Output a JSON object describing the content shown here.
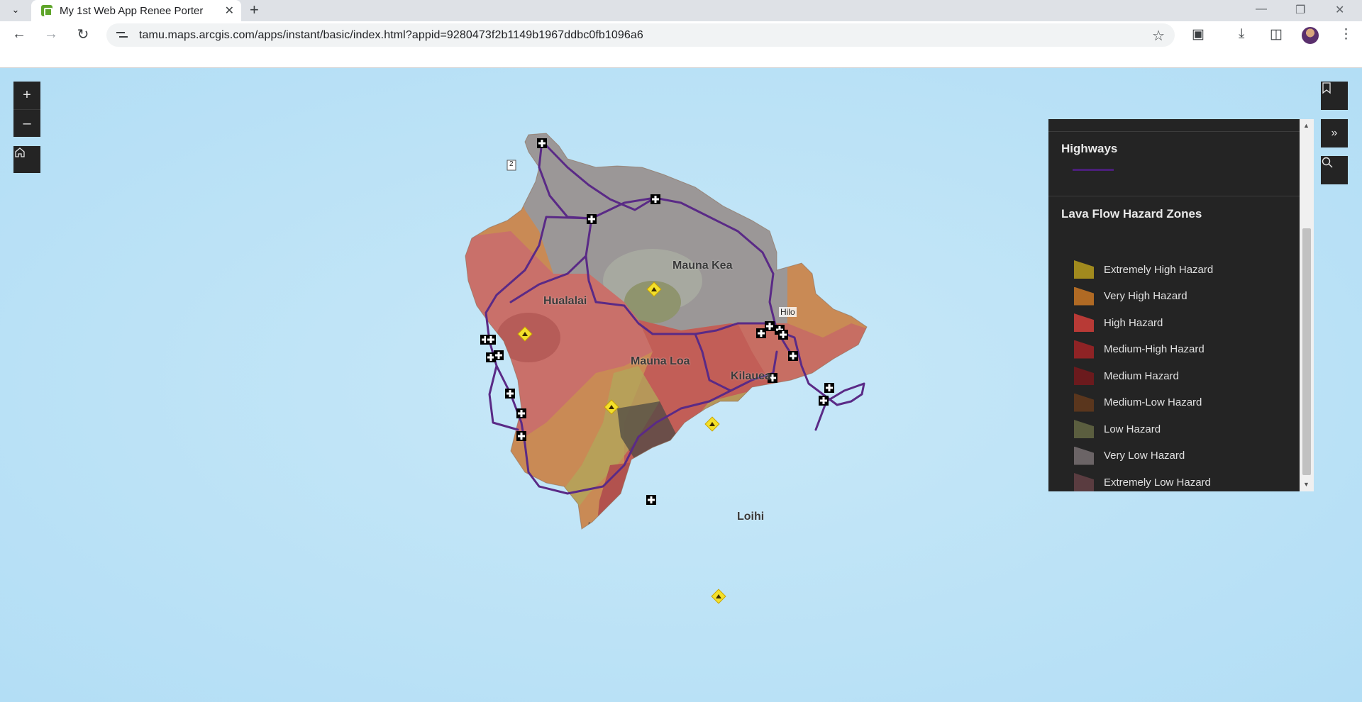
{
  "browser": {
    "tab_title": "My 1st Web App Renee Porter",
    "url": "tamu.maps.arcgis.com/apps/instant/basic/index.html?appid=9280473f2b1149b1967ddbc0fb1096a6"
  },
  "map": {
    "labels": {
      "mauna_kea": "Mauna Kea",
      "hualalai": "Hualalai",
      "mauna_loa": "Mauna Loa",
      "kilauea": "Kilauea",
      "loihi": "Loihi",
      "hilo": "Hilo",
      "route_shield": "2"
    },
    "controls": {
      "zoom_in": "+",
      "zoom_out": "–"
    }
  },
  "legend": {
    "highways_title": "Highways",
    "highways_color": "#4b1f7a",
    "lava_title": "Lava Flow Hazard Zones",
    "items": [
      {
        "label": "Extremely High Hazard",
        "color": "#a18a1e"
      },
      {
        "label": "Very High Hazard",
        "color": "#b06a24"
      },
      {
        "label": "High Hazard",
        "color": "#b83a36"
      },
      {
        "label": "Medium-High Hazard",
        "color": "#8f2325"
      },
      {
        "label": "Medium Hazard",
        "color": "#6b1a1d"
      },
      {
        "label": "Medium-Low Hazard",
        "color": "#5a361d"
      },
      {
        "label": "Low Hazard",
        "color": "#5b5e3f"
      },
      {
        "label": "Very Low Hazard",
        "color": "#6b6466"
      },
      {
        "label": "Extremely Low Hazard",
        "color": "#5a3c40"
      }
    ]
  }
}
